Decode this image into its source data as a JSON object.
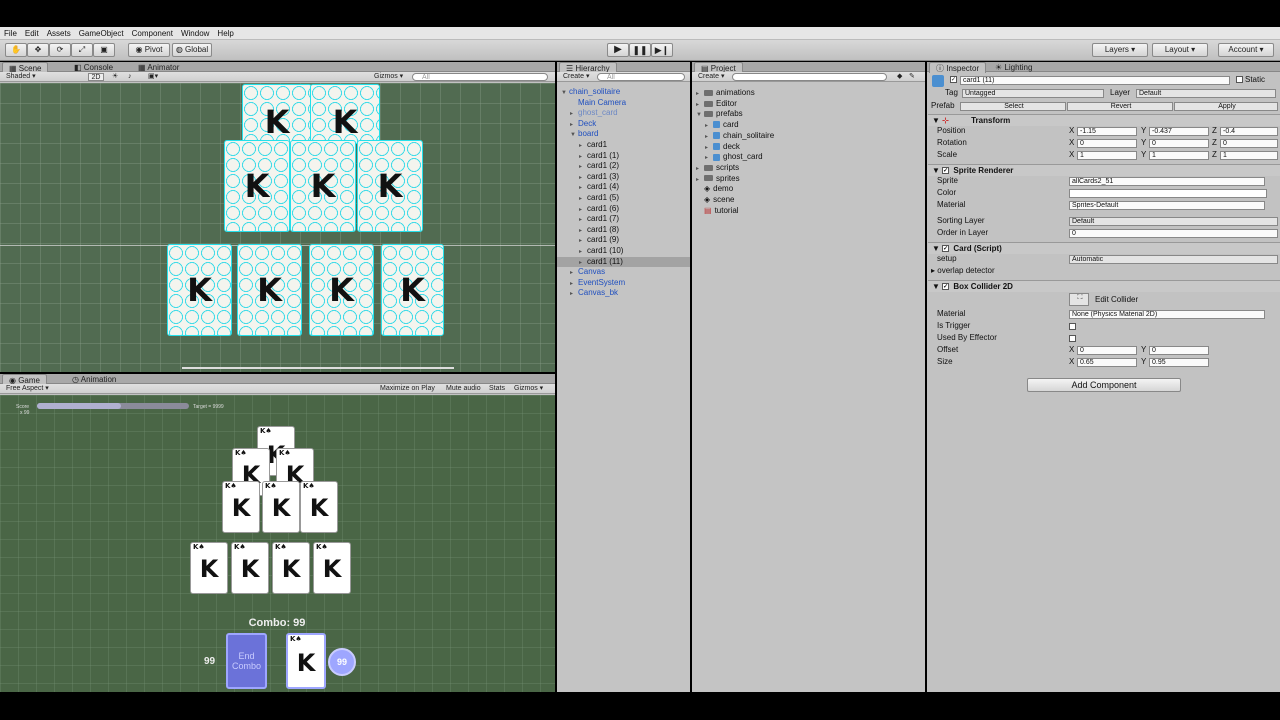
{
  "menu": [
    "File",
    "Edit",
    "Assets",
    "GameObject",
    "Component",
    "Window",
    "Help"
  ],
  "toolbar": {
    "pivot": "Pivot",
    "global": "Global",
    "layers": "Layers",
    "layout": "Layout",
    "account": "Account"
  },
  "scene_panel": {
    "tabs": [
      "Scene",
      "Console",
      "Animator"
    ],
    "shading": "Shaded",
    "mode2d": "2D",
    "gizmos": "Gizmos",
    "search_placeholder": "All"
  },
  "scene_cards": [
    "K",
    "K",
    "K",
    "K",
    "K",
    "K",
    "K",
    "K",
    "K"
  ],
  "game_panel": {
    "tabs": [
      "Game",
      "Animation"
    ],
    "aspect": "Free Aspect",
    "buttons": [
      "Maximize on Play",
      "Mute audio",
      "Stats",
      "Gizmos"
    ],
    "score_label": "Score",
    "score_value": "x 99",
    "target_label": "Target = 9999",
    "combo": "Combo: 99",
    "deck_count": "99",
    "end_combo": "End Combo",
    "undo_count": "99",
    "card_letter": "K",
    "score_progress": 0.55
  },
  "hierarchy": {
    "tab": "Hierarchy",
    "create": "Create",
    "search_placeholder": "All",
    "root": "chain_solitaire",
    "items": [
      {
        "label": "Main Camera",
        "style": "blue"
      },
      {
        "label": "ghost_card",
        "style": "lightblue"
      },
      {
        "label": "Deck",
        "style": "blue"
      },
      {
        "label": "board",
        "style": "blue"
      }
    ],
    "board_children": [
      "card1",
      "card1 (1)",
      "card1 (2)",
      "card1 (3)",
      "card1 (4)",
      "card1 (5)",
      "card1 (6)",
      "card1 (7)",
      "card1 (8)",
      "card1 (9)",
      "card1 (10)",
      "card1 (11)"
    ],
    "after_items": [
      "Canvas",
      "EventSystem",
      "Canvas_bk"
    ]
  },
  "project": {
    "tab": "Project",
    "create": "Create",
    "folders": [
      "animations",
      "Editor",
      "prefabs"
    ],
    "prefabs": [
      "card",
      "chain_solitaire",
      "deck",
      "ghost_card"
    ],
    "more_folders": [
      "scripts",
      "sprites"
    ],
    "scenes": [
      "demo",
      "scene"
    ],
    "other": [
      "tutorial"
    ]
  },
  "inspector": {
    "tabs": [
      "Inspector",
      "Lighting"
    ],
    "object_name": "card1 (11)",
    "static": "Static",
    "tag_label": "Tag",
    "tag": "Untagged",
    "layer_label": "Layer",
    "layer": "Default",
    "prefab_label": "Prefab",
    "prefab_buttons": [
      "Select",
      "Revert",
      "Apply"
    ],
    "transform": {
      "title": "Transform",
      "position": [
        "-1.15",
        "-0.437",
        "-0.4"
      ],
      "rotation": [
        "0",
        "0",
        "0"
      ],
      "scale": [
        "1",
        "1",
        "1"
      ]
    },
    "sprite_renderer": {
      "title": "Sprite Renderer",
      "sprite": "allCards2_51",
      "material": "Sprites-Default",
      "sorting_layer": "Default",
      "order": "0"
    },
    "card_script": {
      "title": "Card (Script)",
      "setup_label": "setup",
      "setup": "Automatic",
      "overlap": "overlap detector"
    },
    "box_collider": {
      "title": "Box Collider 2D",
      "edit": "Edit Collider",
      "material": "None (Physics Material 2D)",
      "offset": [
        "0",
        "0"
      ],
      "size": [
        "0.65",
        "0.95"
      ]
    },
    "add_component": "Add Component",
    "labels": {
      "position": "Position",
      "rotation": "Rotation",
      "scale": "Scale",
      "sprite": "Sprite",
      "color": "Color",
      "material": "Material",
      "sorting_layer": "Sorting Layer",
      "order": "Order in Layer",
      "is_trigger": "Is Trigger",
      "used_by_effector": "Used By Effector",
      "offset": "Offset",
      "size": "Size"
    }
  },
  "colors": {
    "scene_bg": "#516b51",
    "game_bg": "#4a6646",
    "selected_row": "#a3a3a3",
    "end_combo_btn": "#6b72d9"
  }
}
